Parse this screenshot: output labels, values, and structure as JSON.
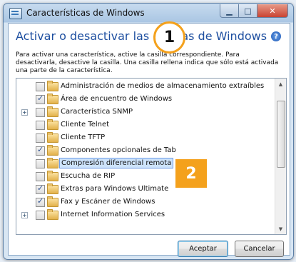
{
  "window": {
    "title": "Características de Windows",
    "heading": "Activar o desactivar las características de Windows",
    "heading_visible": "Activar o desactivar las cara           as de Windows",
    "help_label": "?",
    "description": "Para activar una característica, active la casilla correspondiente. Para desactivarla, desactive la casilla. Una casilla rellena indica que sólo está activada una parte de la característica.",
    "buttons": {
      "ok": "Aceptar",
      "cancel": "Cancelar"
    },
    "title_buttons": {
      "min": "▁",
      "max": "□",
      "close": "✕"
    }
  },
  "features": [
    {
      "label": "Administración de medios de almacenamiento extraíbles",
      "checked": false,
      "expandable": false
    },
    {
      "label": "Área de encuentro de Windows",
      "checked": true,
      "expandable": false
    },
    {
      "label": "Característica SNMP",
      "checked": false,
      "expandable": true
    },
    {
      "label": "Cliente Telnet",
      "checked": false,
      "expandable": false
    },
    {
      "label": "Cliente TFTP",
      "checked": false,
      "expandable": false
    },
    {
      "label": "Componentes opcionales de Tab",
      "checked": true,
      "expandable": false
    },
    {
      "label": "Compresión diferencial remota",
      "checked": false,
      "expandable": false,
      "selected": true
    },
    {
      "label": "Escucha de RIP",
      "checked": false,
      "expandable": false
    },
    {
      "label": "Extras para Windows Ultimate",
      "checked": true,
      "expandable": false
    },
    {
      "label": "Fax y Escáner de Windows",
      "checked": true,
      "expandable": false
    },
    {
      "label": "Internet Information Services",
      "checked": false,
      "expandable": true
    }
  ],
  "callouts": {
    "one": "1",
    "two": "2"
  },
  "colors": {
    "callout": "#f4a11c",
    "heading": "#1e4fa0",
    "selection": "#cde3fb"
  }
}
